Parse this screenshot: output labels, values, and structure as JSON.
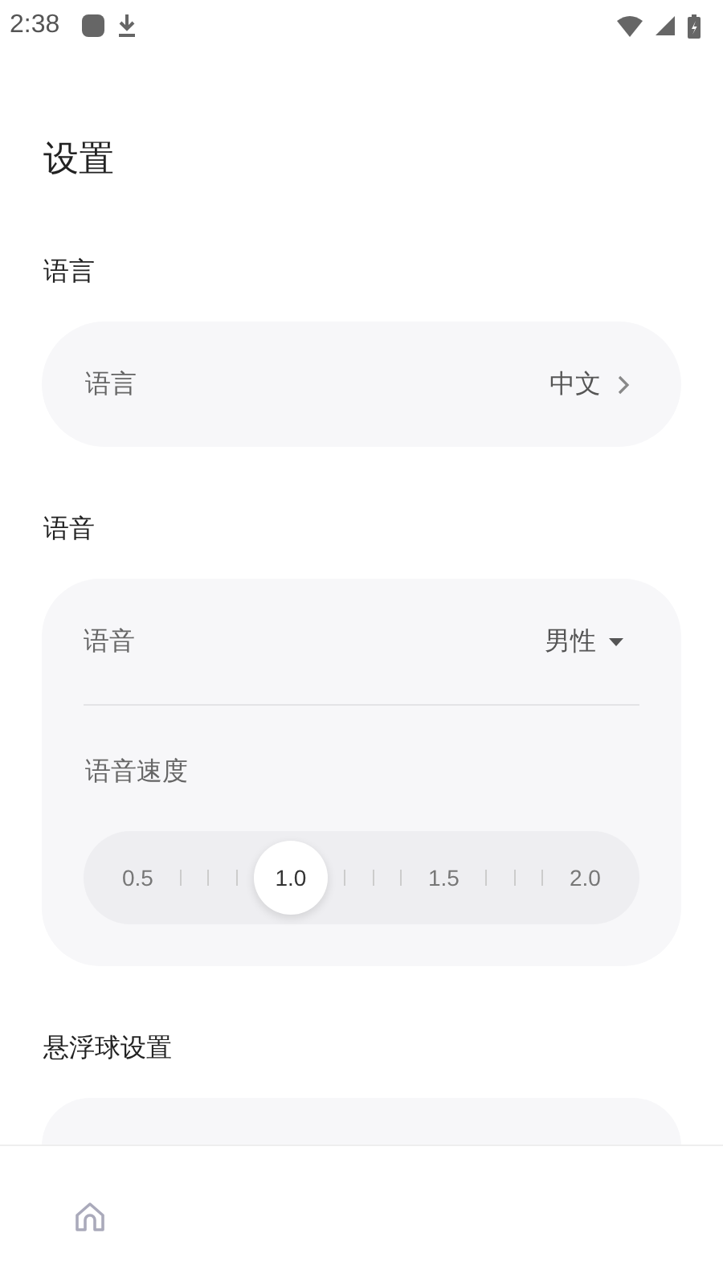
{
  "status_bar": {
    "time": "2:38"
  },
  "title": "设置",
  "sections": [
    {
      "kind": "language",
      "heading": "语言",
      "label": "语言",
      "value": "中文"
    },
    {
      "kind": "voice",
      "heading": "语音",
      "label": "语音",
      "value": "男性",
      "speed_label": "语音速度",
      "speeds": [
        {
          "label": "0.5",
          "selected": false
        },
        {
          "label": "1.0",
          "selected": true
        },
        {
          "label": "1.5",
          "selected": false
        },
        {
          "label": "2.0",
          "selected": false
        }
      ]
    },
    {
      "kind": "float",
      "heading": "悬浮球设置"
    }
  ],
  "bottom_nav": [
    {
      "kind": "home",
      "selected": false
    }
  ]
}
